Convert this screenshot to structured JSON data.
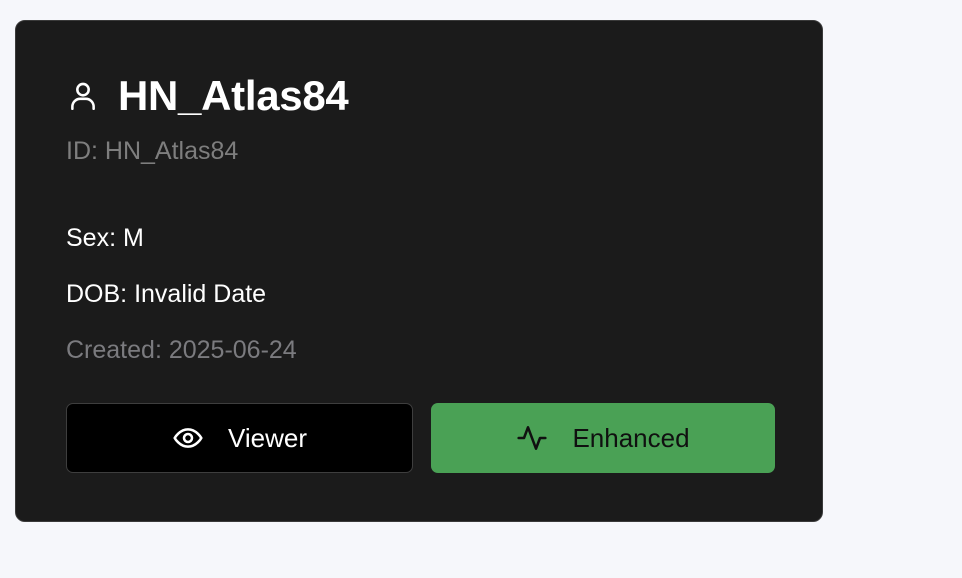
{
  "profile": {
    "name": "HN_Atlas84",
    "id_line": "ID: HN_Atlas84",
    "sex": "Sex: M",
    "dob": "DOB: Invalid Date",
    "created": "Created: 2025-06-24"
  },
  "actions": {
    "viewer_label": "Viewer",
    "viewer_icon": "eye-icon",
    "enhanced_label": "Enhanced",
    "enhanced_icon": "activity-icon"
  },
  "colors": {
    "card_background": "#1b1b1b",
    "page_background": "#f6f7fb",
    "enhanced_accent": "#4aa155",
    "viewer_background": "#000000"
  }
}
